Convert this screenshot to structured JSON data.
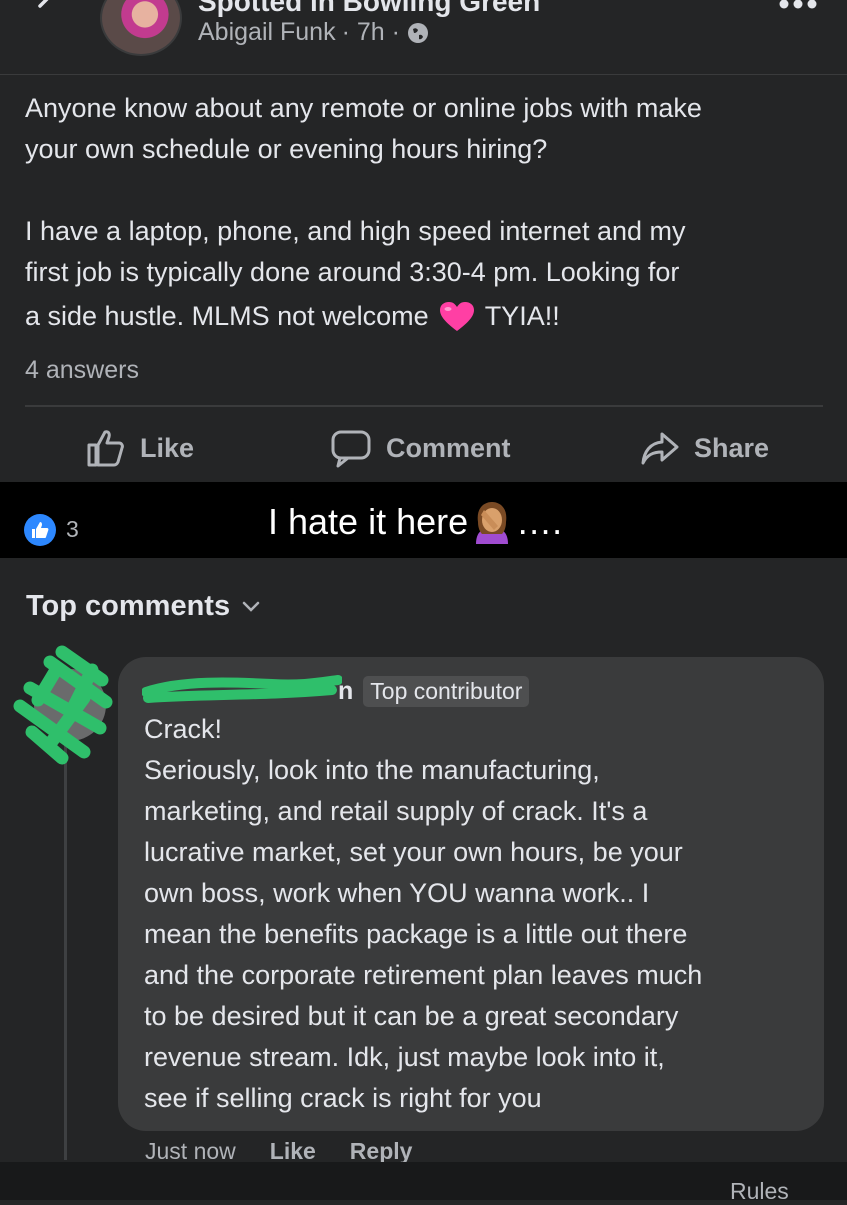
{
  "header": {
    "group_name": "Spotted in Bowling Green",
    "author": "Abigail Funk",
    "time": "· 7h ·",
    "icons": {
      "back": "chevron-left-icon",
      "privacy": "globe-icon",
      "more": "more-dots-icon"
    }
  },
  "post": {
    "body": "Anyone know about any remote or online jobs with make\nyour own schedule or evening hours hiring?\n\nI have a laptop, phone, and high speed internet and my\nfirst job is typically done around 3:30-4 pm. Looking for",
    "last_line_start": "a side hustle. MLMS not welcome",
    "last_line_end": "TYIA!!",
    "answers": "4 answers"
  },
  "actions": {
    "like": "Like",
    "comment": "Comment",
    "share": "Share"
  },
  "reactions": {
    "count": "3"
  },
  "overlay": {
    "text_before": "I hate it here",
    "text_after": "…."
  },
  "comments_header": {
    "label": "Top comments"
  },
  "comment": {
    "name_visible_tail": "n",
    "badge": "Top contributor",
    "text": "Crack!\nSeriously, look into the manufacturing,\nmarketing, and retail supply of crack. It's a\nlucrative market, set your own hours, be your\nown boss, work when YOU wanna work.. I\nmean the benefits package is a little out there\nand the corporate retirement plan leaves much\nto be desired but it can be a great secondary\nrevenue stream. Idk, just maybe look into it,\nsee if selling crack is right for you",
    "time": "Just now",
    "like": "Like",
    "reply": "Reply"
  },
  "footer": {
    "rules": "Rules"
  },
  "colors": {
    "background": "#242526",
    "bubble": "#3a3b3c",
    "text": "#e4e6eb",
    "secondary_text": "#b0b3b8",
    "like_badge": "#2d88ff",
    "heart": "#ff3fa4",
    "redaction_green": "#2fbf6b"
  }
}
